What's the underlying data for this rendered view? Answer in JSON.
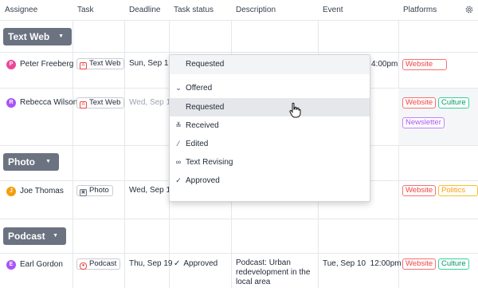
{
  "header": {
    "columns": [
      "Assignee",
      "Task",
      "Deadline",
      "Task status",
      "Description",
      "Event",
      "Platforms"
    ]
  },
  "groups": {
    "text_web": "Text Web",
    "photo": "Photo",
    "podcast": "Podcast"
  },
  "rows": [
    {
      "initial": "P",
      "name": "Peter Freeberg",
      "avatar_color": "#ec4899",
      "task": "Text Web",
      "deadline": "Sun, Sep 15",
      "event_tail": "4:00pm",
      "platforms": [
        "Website"
      ]
    },
    {
      "initial": "R",
      "name": "Rebecca Wilson",
      "avatar_color": "#a855f7",
      "task": "Text Web",
      "deadline": "Wed, Sep 18",
      "platforms": [
        "Website",
        "Culture",
        "Newsletter"
      ]
    },
    {
      "initial": "J",
      "name": "Joe Thomas",
      "avatar_color": "#f59e0b",
      "task": "Photo",
      "deadline": "Wed, Sep 18",
      "platforms": [
        "Website",
        "Politics"
      ]
    },
    {
      "initial": "E",
      "name": "Earl Gordon",
      "avatar_color": "#a855f7",
      "task": "Podcast",
      "deadline": "Thu, Sep 19",
      "status": "Approved",
      "description": "Podcast: Urban redevelopment in the local area",
      "event": "Tue, Sep 10  12:00pm",
      "platforms": [
        "Website",
        "Culture"
      ]
    }
  ],
  "dropdown": {
    "current": "Requested",
    "items": [
      "Offered",
      "Requested",
      "Received",
      "Edited",
      "Text Revising",
      "Approved"
    ],
    "icons": [
      "chevron-down-icon",
      "none",
      "double-chevron-down-icon",
      "pencil-icon",
      "infinity-icon",
      "check-circle-icon"
    ]
  },
  "colors": {
    "group_bg": "#6b7280",
    "website": "#ef4444",
    "culture": "#059669",
    "politics": "#f59e0b",
    "newsletter": "#a855f7"
  }
}
